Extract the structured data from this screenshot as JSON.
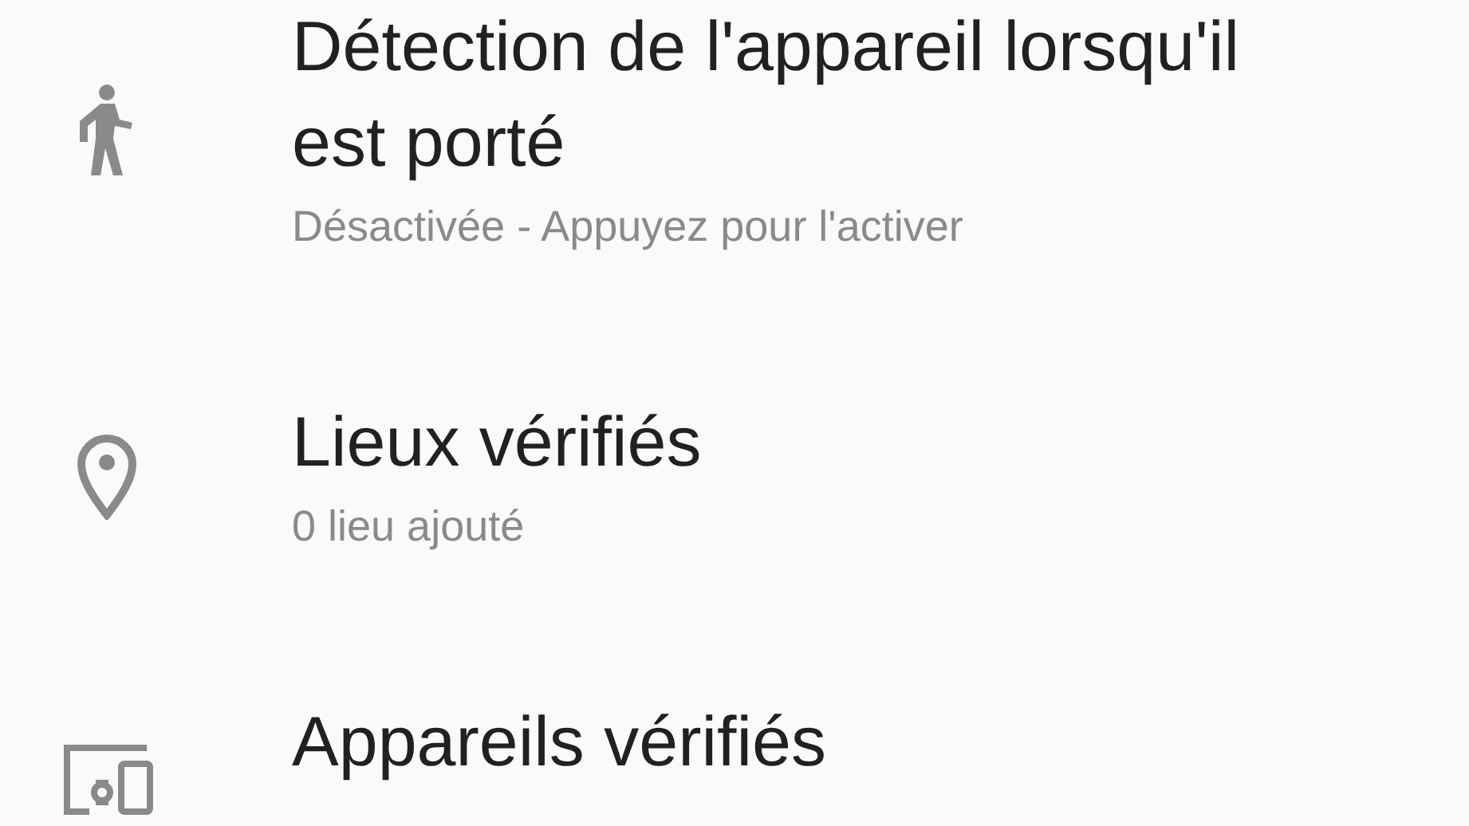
{
  "settings": [
    {
      "kind": "walk",
      "title": "Détection de l'appareil lorsqu'il est porté",
      "subtitle": "Désactivée - Appuyez pour l'activer"
    },
    {
      "kind": "pin",
      "title": "Lieux vérifiés",
      "subtitle": "0 lieu ajouté"
    },
    {
      "kind": "devices",
      "title": "Appareils vérifiés"
    }
  ]
}
